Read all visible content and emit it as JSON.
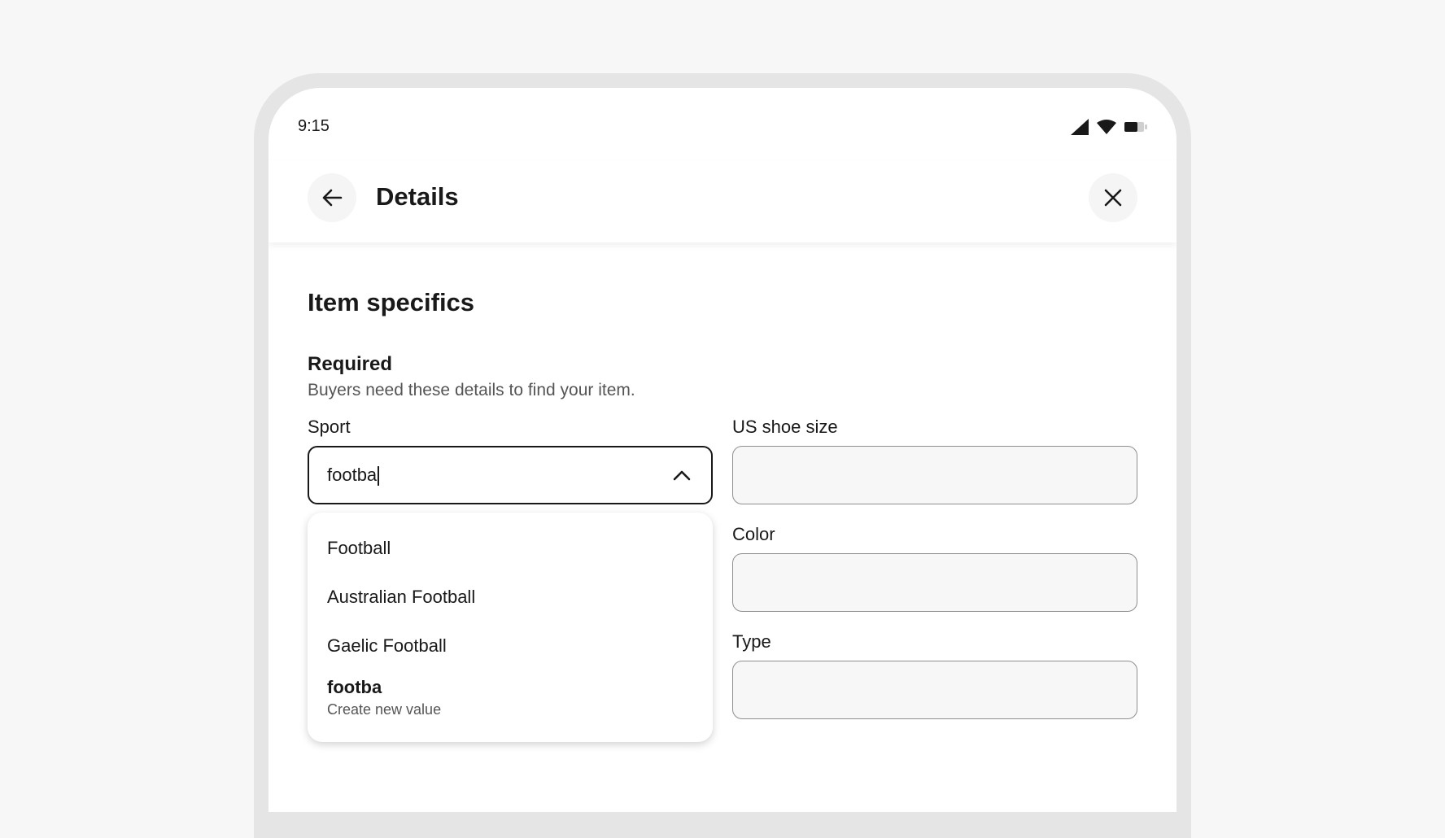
{
  "status_bar": {
    "time": "9:15",
    "icons": [
      "signal-icon",
      "wifi-icon",
      "battery-icon"
    ]
  },
  "app_bar": {
    "title": "Details",
    "back_icon": "arrow-left-icon",
    "close_icon": "close-icon"
  },
  "section": {
    "title": "Item specifics",
    "required_title": "Required",
    "required_subtitle": "Buyers need these details to find your item."
  },
  "fields": {
    "sport": {
      "label": "Sport",
      "value": "footba",
      "options": [
        "Football",
        "Australian Football",
        "Gaelic Football"
      ],
      "create_new": {
        "value": "footba",
        "hint": "Create new value"
      }
    },
    "shoe_size": {
      "label": "US shoe size",
      "value": ""
    },
    "color": {
      "label": "Color",
      "value": ""
    },
    "type": {
      "label": "Type",
      "value": ""
    }
  },
  "colors": {
    "background": "#f7f7f7",
    "frame": "#e5e5e5",
    "text": "#191919",
    "muted": "#555555",
    "input_border": "#8f8f8f"
  }
}
